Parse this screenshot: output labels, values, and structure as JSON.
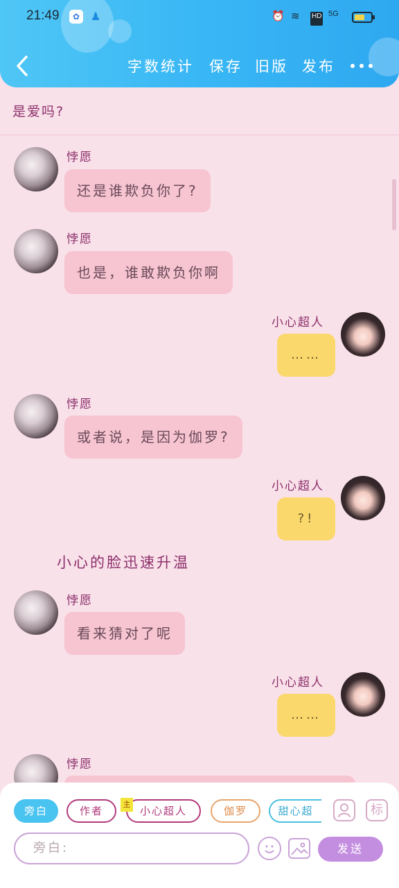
{
  "status_bar": {
    "time": "21:49",
    "network": "5G",
    "hd": "HD"
  },
  "header": {
    "nav_items": [
      "字数统计",
      "保存",
      "旧版",
      "发布"
    ]
  },
  "top_text": "是爱吗?",
  "messages": [
    {
      "side": "left",
      "name": "悖愿",
      "text": "还是谁欺负你了?"
    },
    {
      "side": "left",
      "name": "悖愿",
      "text": "也是，谁敢欺负你啊"
    },
    {
      "side": "right",
      "name": "小心超人",
      "text": "……"
    },
    {
      "side": "left",
      "name": "悖愿",
      "text": "或者说，是因为伽罗?"
    },
    {
      "side": "right",
      "name": "小心超人",
      "text": "?!"
    },
    {
      "side": "left",
      "name": "悖愿",
      "text": "看来猜对了呢"
    },
    {
      "side": "right",
      "name": "小心超人",
      "text": "……"
    },
    {
      "side": "left",
      "name": "悖愿",
      "text": ""
    }
  ],
  "aside_text": "小心的脸迅速升温",
  "composer": {
    "roles": [
      "旁白",
      "作者",
      "小心超人",
      "伽罗",
      "甜心超"
    ],
    "main_badge": "主",
    "input_placeholder": "旁白:",
    "send_label": "发送",
    "mark_label": "标"
  },
  "colors": {
    "header": "#39b7f5",
    "background": "#f9e1ea",
    "left_bubble": "#f7c4d2",
    "right_bubble": "#fbd86b",
    "name": "#8c2f6a",
    "send": "#c48ee0"
  }
}
